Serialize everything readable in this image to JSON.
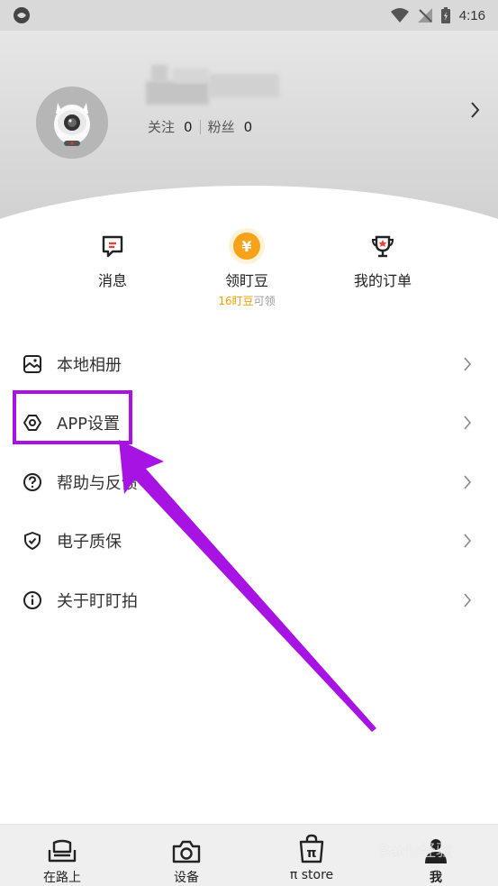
{
  "status_bar": {
    "time": "4:16"
  },
  "profile": {
    "follow_label": "关注",
    "follow_count": "0",
    "fans_label": "粉丝",
    "fans_count": "0"
  },
  "quick_actions": [
    {
      "label": "消息",
      "icon": "message-icon"
    },
    {
      "label": "领盯豆",
      "icon": "yuan-coin-icon",
      "sub_highlight": "16盯豆",
      "sub_text": "可领"
    },
    {
      "label": "我的订单",
      "icon": "trophy-icon"
    }
  ],
  "menu": {
    "items": [
      {
        "label": "本地相册",
        "icon": "album-icon"
      },
      {
        "label": "APP设置",
        "icon": "settings-icon"
      },
      {
        "label": "帮助与反馈",
        "icon": "help-icon"
      },
      {
        "label": "电子质保",
        "icon": "shield-icon"
      },
      {
        "label": "关于盯盯拍",
        "icon": "info-icon"
      }
    ]
  },
  "bottom_nav": {
    "items": [
      {
        "label": "在路上",
        "icon": "car-seat-icon"
      },
      {
        "label": "设备",
        "icon": "camera-icon"
      },
      {
        "label": "π store",
        "icon": "shopping-bag-icon"
      },
      {
        "label": "我",
        "icon": "person-icon",
        "active": true
      }
    ]
  },
  "annotation": {
    "color": "#a713e3"
  },
  "watermark": "Baidu经验",
  "colors": {
    "accent_orange": "#f5a000",
    "annotation_purple": "#a713e3",
    "header_gray": "#d8d8d8"
  }
}
